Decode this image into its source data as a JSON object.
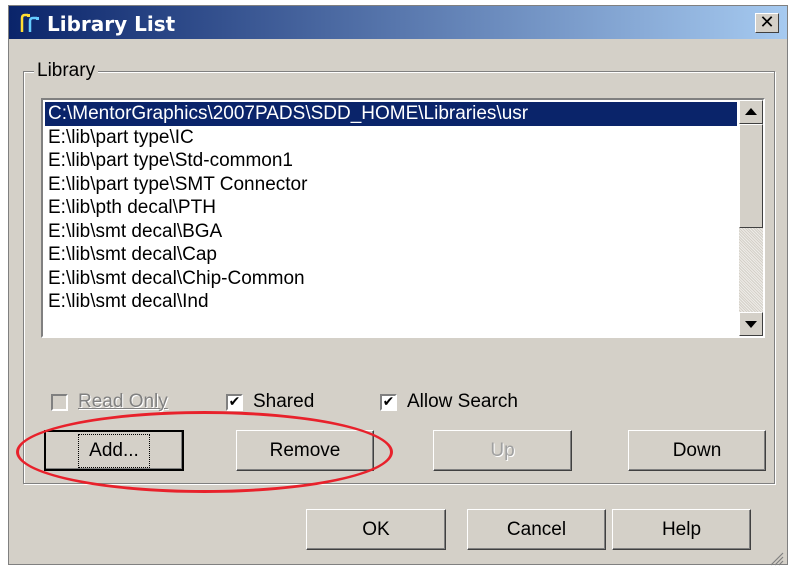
{
  "window": {
    "title": "Library List",
    "close_label": "✕"
  },
  "group": {
    "label": "Library"
  },
  "list": {
    "items": [
      "C:\\MentorGraphics\\2007PADS\\SDD_HOME\\Libraries\\usr",
      "E:\\lib\\part type\\IC",
      "E:\\lib\\part type\\Std-common1",
      "E:\\lib\\part type\\SMT Connector",
      "E:\\lib\\pth decal\\PTH",
      "E:\\lib\\smt decal\\BGA",
      "E:\\lib\\smt decal\\Cap",
      "E:\\lib\\smt decal\\Chip-Common",
      "E:\\lib\\smt decal\\Ind"
    ],
    "selected_index": 0
  },
  "checkboxes": {
    "read_only": {
      "label": "Read Only",
      "checked": false,
      "enabled": false
    },
    "shared": {
      "label": "Shared",
      "checked": true,
      "enabled": true
    },
    "allow_search": {
      "label": "Allow Search",
      "checked": true,
      "enabled": true
    }
  },
  "buttons": {
    "add": "Add...",
    "remove": "Remove",
    "up": "Up",
    "down": "Down",
    "ok": "OK",
    "cancel": "Cancel",
    "help": "Help"
  },
  "colors": {
    "selection": "#0a246a",
    "annotation": "#e8212b",
    "titlebar": "#0a246a"
  },
  "icons": {
    "app": "library-app-icon",
    "close": "close-icon",
    "scroll_up": "scroll-up-arrow-icon",
    "scroll_down": "scroll-down-arrow-icon",
    "check": "checkmark-icon"
  }
}
